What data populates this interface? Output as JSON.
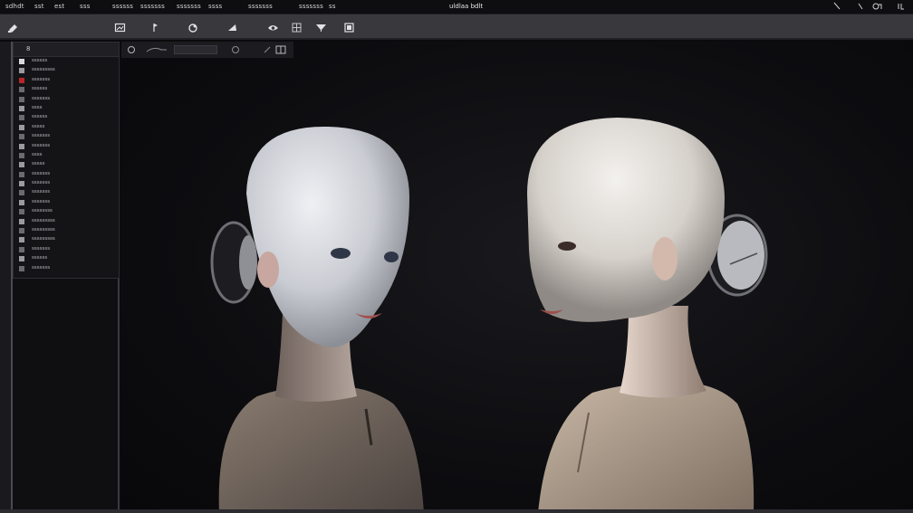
{
  "menubar": {
    "items": [
      "sdhdt",
      "sst",
      "est",
      "sss",
      "ssssss",
      "sssssss",
      "sssssss",
      "ssss",
      "sssssss",
      "sssssss",
      "ss"
    ],
    "title": "uldlaa bdlt"
  },
  "scene_panel": {
    "title": "8",
    "layers": [
      "ssssss",
      "sssssssss",
      "sssssss",
      "ssssss",
      "sssssss",
      "ssss",
      "ssssss",
      "sssss",
      "sssssss",
      "sssssss",
      "ssss",
      "sssss",
      "sssssss",
      "sssssss",
      "sssssss",
      "sssssss",
      "ssssssss",
      "sssssssss",
      "sssssssss",
      "sssssssss",
      "sssssss",
      "ssssss",
      "sssssss"
    ]
  },
  "icons": {
    "toolbar": [
      "cursor-icon",
      "image-icon",
      "flag-icon",
      "paint-icon",
      "triangle-icon",
      "camera-icon",
      "grid-icon",
      "funnel-icon",
      "panel-icon"
    ],
    "window": [
      "arrow-icon",
      "minimize-icon",
      "restore-icon",
      "close-icon"
    ],
    "viewport": [
      "shading-icon",
      "view-menu-icon",
      "zoom-field",
      "globe-icon",
      "snap-icon",
      "layout-icon"
    ]
  },
  "colors": {
    "toolbar": "#38383d",
    "panel": "#141417",
    "viewport": "#0d0d10",
    "accent_red": "#b8262b"
  }
}
